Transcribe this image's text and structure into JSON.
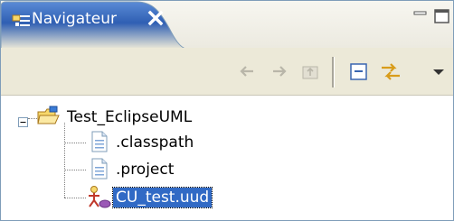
{
  "view_tab": {
    "title": "Navigateur",
    "icon": "navigator-view-icon",
    "close_icon": "close-icon"
  },
  "window_controls": {
    "minimize_icon": "minimize-icon",
    "maximize_icon": "maximize-icon"
  },
  "toolbar": {
    "buttons": [
      {
        "icon": "back-arrow-icon",
        "enabled": false
      },
      {
        "icon": "forward-arrow-icon",
        "enabled": false
      },
      {
        "icon": "up-folder-icon",
        "enabled": false
      },
      {
        "icon": "collapse-all-icon",
        "enabled": true
      },
      {
        "icon": "link-with-editor-icon",
        "enabled": true
      },
      {
        "icon": "view-menu-icon",
        "enabled": true
      }
    ]
  },
  "tree": {
    "root": {
      "label": "Test_EclipseUML",
      "icon": "project-folder-icon",
      "expanded": true,
      "children": [
        {
          "label": ".classpath",
          "icon": "file-icon",
          "selected": false
        },
        {
          "label": ".project",
          "icon": "file-icon",
          "selected": false
        },
        {
          "label": "CU_test.uud",
          "icon": "use-case-diagram-icon",
          "selected": true
        }
      ]
    }
  },
  "colors": {
    "tab_active": "#2f5fb3",
    "selection": "#316ac5",
    "toolbar_bg": "#ece9d8"
  }
}
